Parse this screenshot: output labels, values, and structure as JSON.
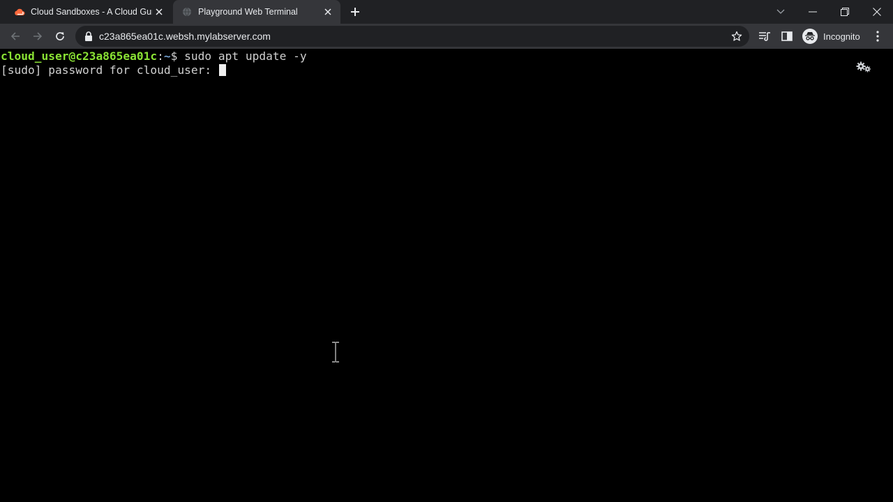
{
  "browser": {
    "tabs": [
      {
        "title": "Cloud Sandboxes - A Cloud Guru",
        "favicon": "cloud-icon",
        "active": false
      },
      {
        "title": "Playground Web Terminal",
        "favicon": "globe-icon",
        "active": true
      }
    ],
    "address": {
      "url": "c23a865ea01c.websh.mylabserver.com"
    },
    "profile": {
      "label": "Incognito"
    }
  },
  "terminal": {
    "line1": {
      "user_host": "cloud_user@c23a865ea01c",
      "separator": ":",
      "path": "~",
      "prompt_symbol": "$ ",
      "command": "sudo apt update -y"
    },
    "line2": {
      "text": "[sudo] password for cloud_user: "
    }
  },
  "colors": {
    "prompt_user": "#8ae234",
    "prompt_path": "#729fcf",
    "terminal_bg": "#000000",
    "tab_accent": "#ff6a3d"
  }
}
